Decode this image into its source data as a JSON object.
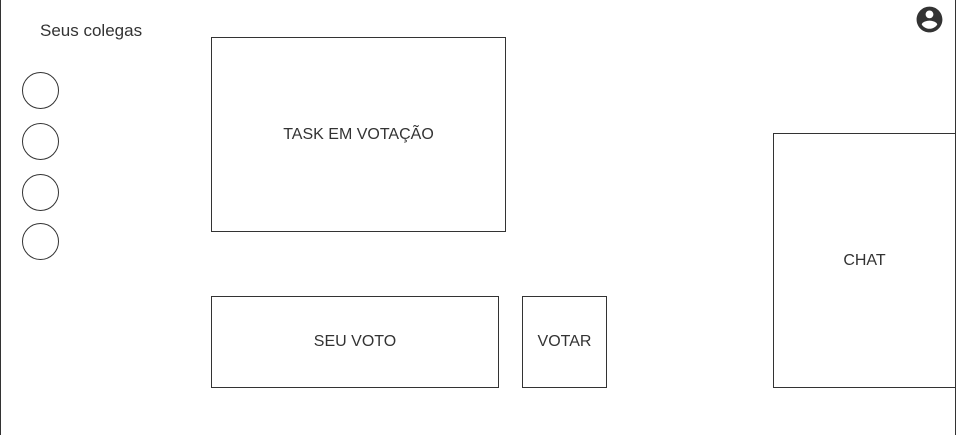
{
  "colleagues": {
    "title": "Seus colegas",
    "avatars": [
      {
        "icon": "colleague-avatar-circle"
      },
      {
        "icon": "colleague-avatar-circle"
      },
      {
        "icon": "colleague-avatar-circle"
      },
      {
        "icon": "colleague-avatar-circle"
      }
    ]
  },
  "task": {
    "label": "TASK EM VOTAÇÃO"
  },
  "vote": {
    "label": "SEU VOTO",
    "button_label": "VOTAR"
  },
  "chat": {
    "label": "CHAT"
  },
  "header": {
    "account_icon": "account-circle-icon"
  },
  "colors": {
    "stroke": "#333333",
    "text": "#333333",
    "background": "#ffffff"
  }
}
